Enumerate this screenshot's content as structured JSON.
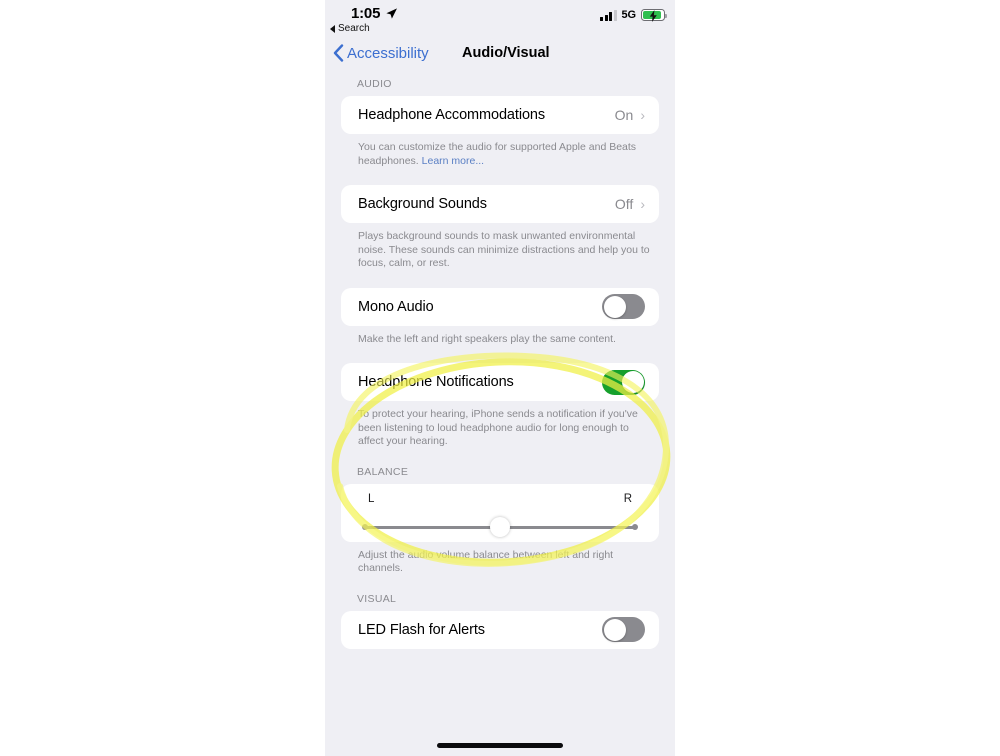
{
  "status_bar": {
    "time": "1:05",
    "location_icon": "location-arrow-icon",
    "back_app_label": "Search",
    "network": "5G",
    "signal_icon": "signal-bars-icon",
    "battery_icon": "battery-charging-icon"
  },
  "nav": {
    "back_label": "Accessibility",
    "title": "Audio/Visual"
  },
  "sections": {
    "audio_header": "AUDIO",
    "balance_header": "BALANCE",
    "visual_header": "VISUAL"
  },
  "rows": {
    "headphone_accommodations": {
      "label": "Headphone Accommodations",
      "value": "On",
      "chevron": "›"
    },
    "headphone_accommodations_note": {
      "text": "You can customize the audio for supported Apple and Beats headphones. ",
      "link": "Learn more..."
    },
    "background_sounds": {
      "label": "Background Sounds",
      "value": "Off",
      "chevron": "›"
    },
    "background_sounds_note": "Plays background sounds to mask unwanted environmental noise. These sounds can minimize distractions and help you to focus, calm, or rest.",
    "mono_audio": {
      "label": "Mono Audio",
      "state": "off"
    },
    "mono_audio_note": "Make the left and right speakers play the same content.",
    "headphone_notifications": {
      "label": "Headphone Notifications",
      "state": "on"
    },
    "headphone_notifications_note": "To protect your hearing, iPhone sends a notification if you've been listening to loud headphone audio for long enough to affect your hearing.",
    "led_flash": {
      "label": "LED Flash for Alerts",
      "state": "off"
    }
  },
  "balance": {
    "left_label": "L",
    "right_label": "R",
    "value_percent": 50,
    "note": "Adjust the audio volume balance between left and right channels."
  },
  "annotation": {
    "type": "highlighter-ellipse",
    "color": "#f2f24a",
    "target": "headphone-notifications-row"
  },
  "colors": {
    "page_background": "#efeff4",
    "card": "#ffffff",
    "accent_blue": "#3c6fd0",
    "toggle_on_green": "#16a02c",
    "toggle_off_gray": "#8a8a8f",
    "secondary_text": "#8a8a8f",
    "highlighter_yellow": "#f2f24a"
  }
}
